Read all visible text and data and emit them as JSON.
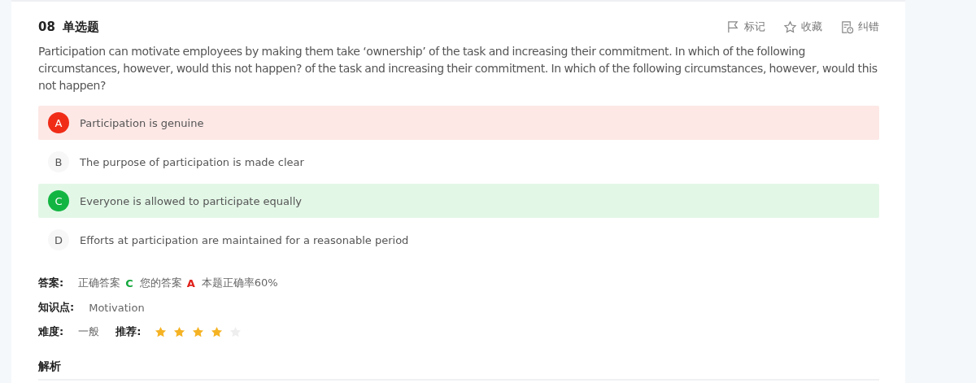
{
  "question": {
    "number": "08",
    "type": "单选题",
    "text": "Participation can motivate employees by making them take  ‘ownership’  of the task and increasing their commitment. In which of the following circumstances, however, would this not happen? of the task and increasing their commitment. In which of the following circumstances, however, would this not happen?"
  },
  "actions": [
    {
      "kind": "flag",
      "label": "标记"
    },
    {
      "kind": "star",
      "label": "收藏"
    },
    {
      "kind": "report",
      "label": "纠错"
    }
  ],
  "options": [
    {
      "letter": "A",
      "text": "Participation is genuine",
      "selected": true,
      "correct": false
    },
    {
      "letter": "B",
      "text": "The purpose of participation is made clear",
      "selected": false,
      "correct": false
    },
    {
      "letter": "C",
      "text": "Everyone is allowed to participate equally",
      "selected": false,
      "correct": true
    },
    {
      "letter": "D",
      "text": "Efforts at participation are maintained for a reasonable period",
      "selected": false,
      "correct": false
    }
  ],
  "answer": {
    "label": "答案:",
    "correct_label": "正确答案",
    "correct": "C",
    "yours_label": "您的答案",
    "yours": "A",
    "rate": "本题正确率60%"
  },
  "topic": {
    "label": "知识点:",
    "value": "Motivation"
  },
  "difficulty": {
    "label": "难度:",
    "value": "一般"
  },
  "recommend": {
    "label": "推荐:",
    "stars": 4
  },
  "analysis": {
    "title": "解析"
  }
}
